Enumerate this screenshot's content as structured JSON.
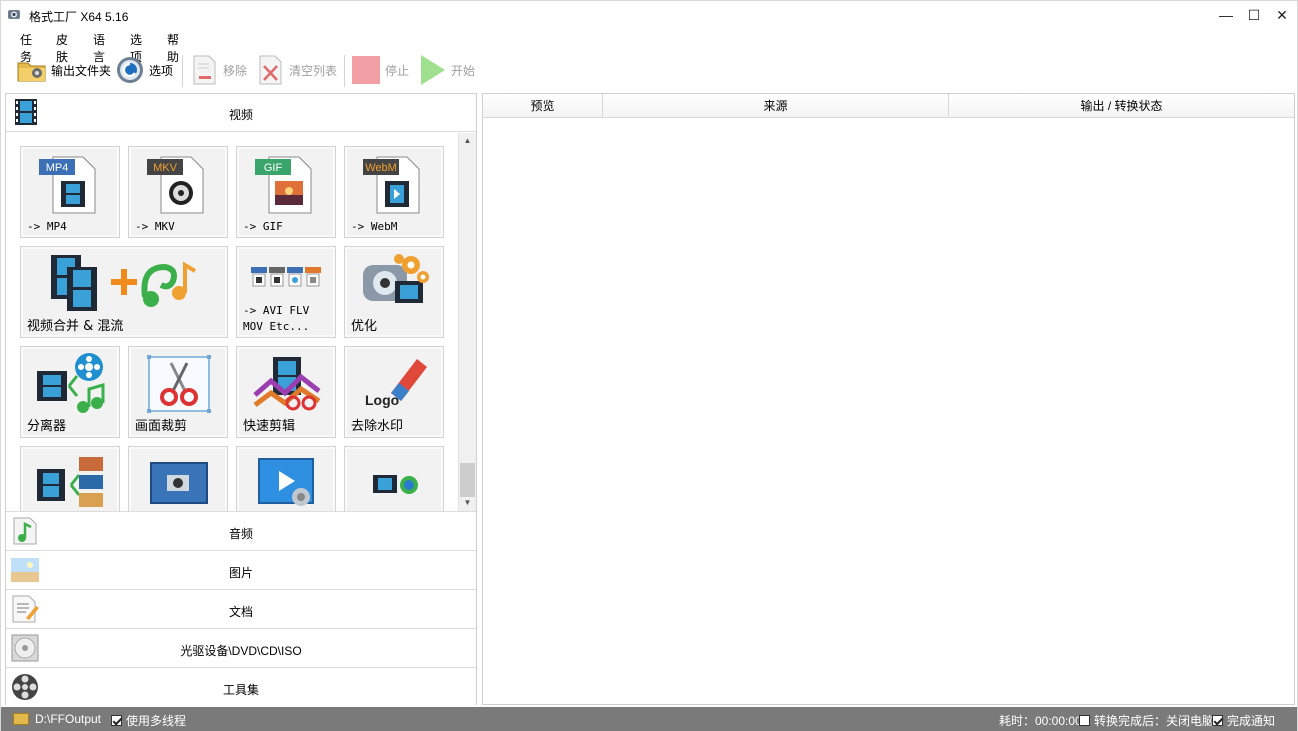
{
  "app": {
    "title": "格式工厂 X64 5.16"
  },
  "window_controls": {
    "minimize": "—",
    "maximize": "☐",
    "close": "✕"
  },
  "menu": [
    "任务",
    "皮肤",
    "语言",
    "选项",
    "帮助"
  ],
  "toolbar": {
    "output_folder": "输出文件夹",
    "options": "选项",
    "remove": "移除",
    "clear_list": "清空列表",
    "stop": "停止",
    "start": "开始"
  },
  "categories": {
    "video": "视频",
    "audio": "音频",
    "image": "图片",
    "document": "文档",
    "disc": "光驱设备\\DVD\\CD\\ISO",
    "tools": "工具集"
  },
  "video_tiles": [
    {
      "label": "-> MP4",
      "badge": "MP4",
      "badge_color": "#3b6fb6"
    },
    {
      "label": "-> MKV",
      "badge": "MKV",
      "badge_color": "#444444"
    },
    {
      "label": "-> GIF",
      "badge": "GIF",
      "badge_color": "#3aa56b"
    },
    {
      "label": "-> WebM",
      "badge": "WebM",
      "badge_color": "#444444"
    },
    {
      "label": "视频合并 & 混流"
    },
    {
      "label": "-> AVI FLV\nMOV Etc..."
    },
    {
      "label": "优化"
    },
    {
      "label": "分离器"
    },
    {
      "label": "画面裁剪"
    },
    {
      "label": "快速剪辑"
    },
    {
      "label": "去除水印",
      "logo_text": "Logo"
    }
  ],
  "file_list": {
    "columns": [
      "预览",
      "来源",
      "输出 / 转换状态"
    ]
  },
  "status": {
    "output_path": "D:\\FFOutput",
    "multithread": "使用多线程",
    "elapsed": "耗时：00:00:00",
    "after_convert": "转换完成后：关闭电脑",
    "notify": "完成通知"
  },
  "colors": {
    "accent_orange": "#f08a1d",
    "statusbar": "#7a7a7a"
  }
}
